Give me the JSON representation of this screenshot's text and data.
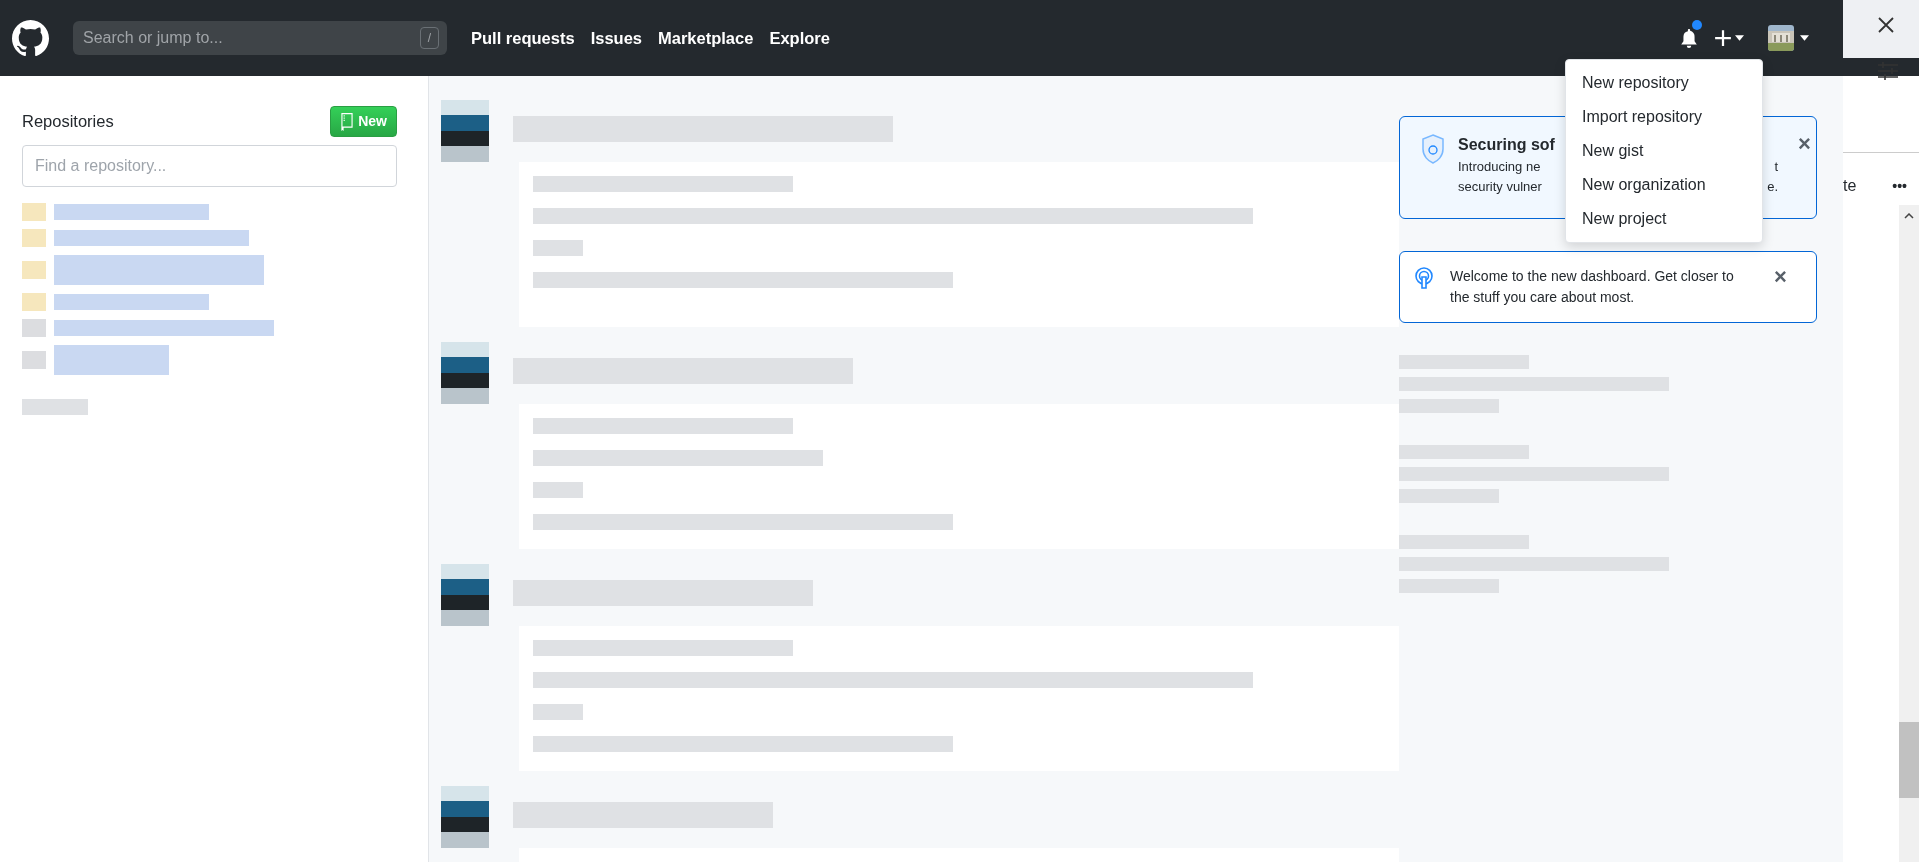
{
  "header": {
    "search": {
      "placeholder": "Search or jump to...",
      "shortcut": "/"
    },
    "nav": [
      {
        "label": "Pull requests"
      },
      {
        "label": "Issues"
      },
      {
        "label": "Marketplace"
      },
      {
        "label": "Explore"
      }
    ],
    "notifications": {
      "unread": true
    }
  },
  "create_menu": {
    "expanded": true,
    "items": [
      {
        "label": "New repository"
      },
      {
        "label": "Import repository"
      },
      {
        "label": "New gist"
      },
      {
        "label": "New organization"
      },
      {
        "label": "New project"
      }
    ]
  },
  "sidebar": {
    "title": "Repositories",
    "new_button": "New",
    "filter": {
      "placeholder": "Find a repository..."
    },
    "repositories": [
      {
        "kind": "blurred"
      },
      {
        "kind": "blurred"
      },
      {
        "kind": "blurred"
      },
      {
        "kind": "blurred"
      },
      {
        "kind": "blurred"
      },
      {
        "kind": "blurred"
      }
    ]
  },
  "feed": {
    "items": [
      {
        "kind": "blurred"
      },
      {
        "kind": "blurred"
      },
      {
        "kind": "blurred"
      },
      {
        "kind": "blurred"
      }
    ]
  },
  "notices": [
    {
      "kind": "security",
      "title": "Securing sof",
      "lines": [
        [
          "Introducing ne",
          "t"
        ],
        [
          "security vulner",
          "e."
        ]
      ],
      "close": "×"
    },
    {
      "kind": "welcome",
      "text": "Welcome to the new dashboard. Get closer to the stuff you care about most.",
      "close": "×"
    }
  ],
  "side_panel": {
    "label": "te",
    "more": "•••"
  }
}
